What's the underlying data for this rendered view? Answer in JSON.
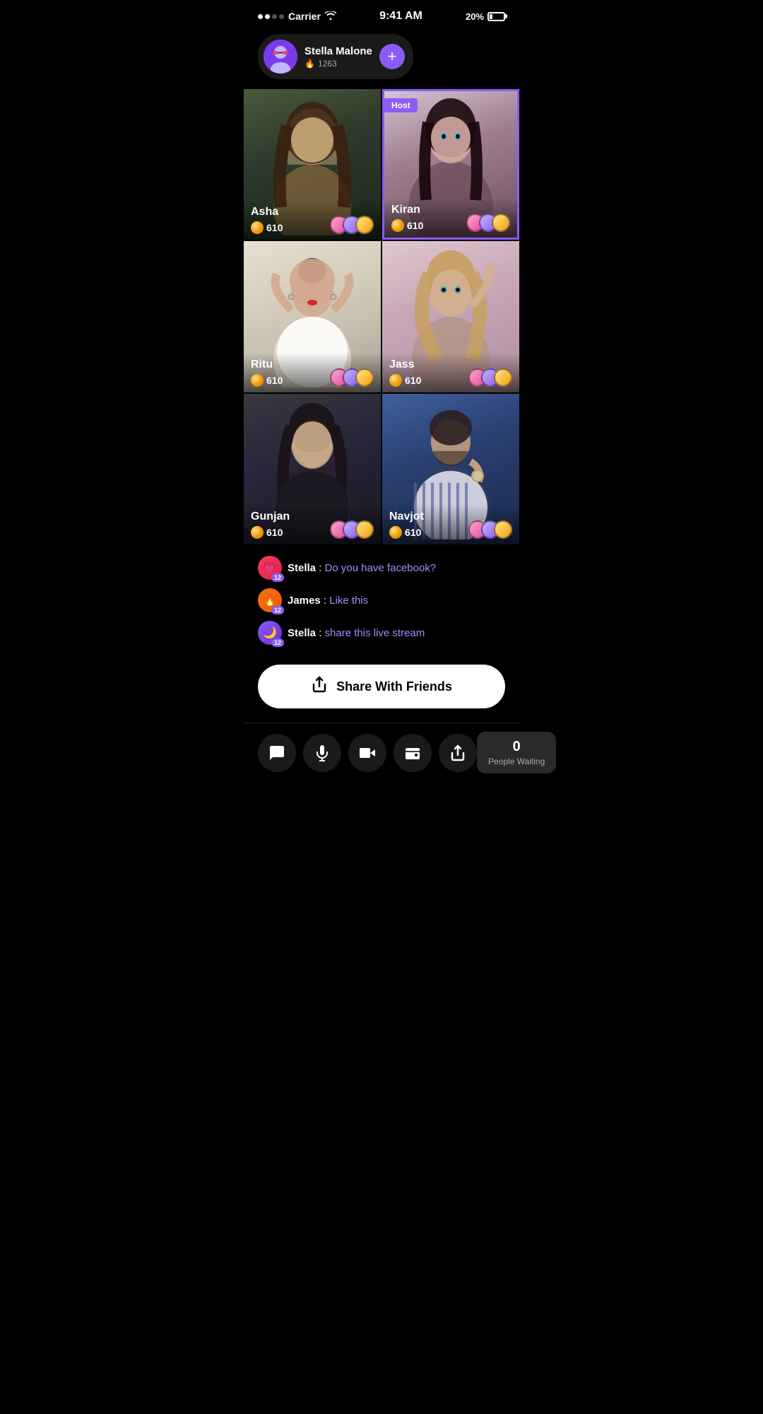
{
  "statusBar": {
    "carrier": "Carrier",
    "time": "9:41 AM",
    "battery": "20%"
  },
  "userHeader": {
    "name": "Stella Malone",
    "score": "1263",
    "addButtonLabel": "+"
  },
  "videoGrid": [
    {
      "id": "asha",
      "name": "Asha",
      "coins": "610",
      "isHost": false,
      "bgClass": "bg-asha"
    },
    {
      "id": "kiran",
      "name": "Kiran",
      "coins": "610",
      "isHost": true,
      "bgClass": "bg-kiran"
    },
    {
      "id": "ritu",
      "name": "Ritu",
      "coins": "610",
      "isHost": false,
      "bgClass": "bg-ritu"
    },
    {
      "id": "jass",
      "name": "Jass",
      "coins": "610",
      "isHost": false,
      "bgClass": "bg-jass"
    },
    {
      "id": "gunjan",
      "name": "Gunjan",
      "coins": "610",
      "isHost": false,
      "bgClass": "bg-gunjan"
    },
    {
      "id": "navjot",
      "name": "Navjot",
      "coins": "610",
      "isHost": false,
      "bgClass": "bg-navjot"
    }
  ],
  "hostBadge": "Host",
  "chatMessages": [
    {
      "id": "msg1",
      "avatarType": "heart",
      "level": "12",
      "sender": "Stella",
      "text": "Do you have facebook?"
    },
    {
      "id": "msg2",
      "avatarType": "fire",
      "level": "12",
      "sender": "James",
      "text": "Like this"
    },
    {
      "id": "msg3",
      "avatarType": "moon",
      "level": "12",
      "sender": "Stella",
      "text": "share this live stream"
    }
  ],
  "shareButton": {
    "label": "Share With Friends"
  },
  "bottomBar": {
    "buttons": [
      {
        "id": "chat",
        "icon": "💬",
        "label": "Chat"
      },
      {
        "id": "mic",
        "icon": "🎤",
        "label": "Microphone"
      },
      {
        "id": "video",
        "icon": "🎥",
        "label": "Video"
      },
      {
        "id": "wallet",
        "icon": "👛",
        "label": "Wallet"
      },
      {
        "id": "share",
        "icon": "↗",
        "label": "Share"
      }
    ],
    "waitingCount": "0",
    "waitingLabel": "People Waiting"
  }
}
